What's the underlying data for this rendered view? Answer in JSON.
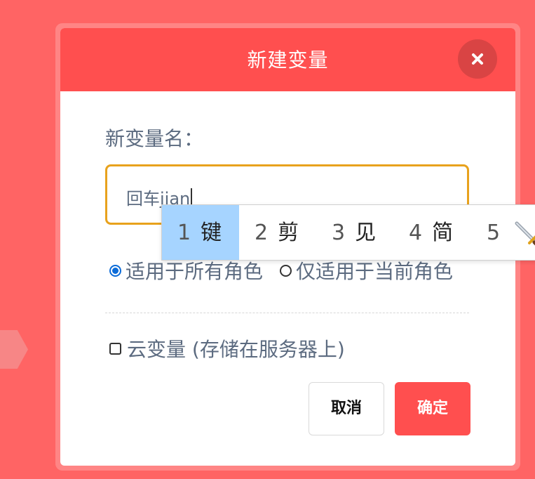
{
  "dialog": {
    "title": "新建变量",
    "close_icon": "close-x-icon",
    "field_label": "新变量名：",
    "input": {
      "value": "回车",
      "composition": "jian"
    },
    "scope_options": [
      {
        "label": "适用于所有角色",
        "checked": true
      },
      {
        "label": "仅适用于当前角色",
        "checked": false
      }
    ],
    "cloud_option": {
      "label": "云变量 (存储在服务器上)",
      "checked": false
    },
    "cancel_label": "取消",
    "confirm_label": "确定"
  },
  "ime": {
    "candidates": [
      {
        "num": "1",
        "text": "键",
        "selected": true
      },
      {
        "num": "2",
        "text": "剪",
        "selected": false
      },
      {
        "num": "3",
        "text": "见",
        "selected": false
      },
      {
        "num": "4",
        "text": "简",
        "selected": false
      },
      {
        "num": "5",
        "text": "",
        "icon": "sword-emoji-icon",
        "selected": false
      }
    ]
  },
  "colors": {
    "header": "#FF4F4F",
    "backdrop": "#FF6464",
    "input_border": "#E8A21D",
    "radio_accent": "#0B6BD8",
    "ime_highlight": "#A6D4FF"
  }
}
